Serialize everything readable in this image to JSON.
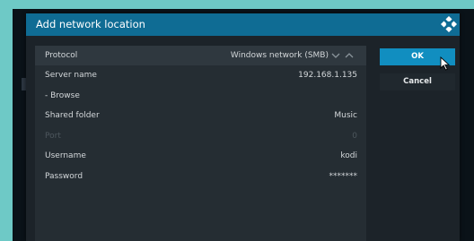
{
  "dialog": {
    "title": "Add network location"
  },
  "fields": {
    "protocol": {
      "label": "Protocol",
      "value": "Windows network (SMB)"
    },
    "server_name": {
      "label": "Server name",
      "value": "192.168.1.135"
    },
    "browse": {
      "label": "- Browse"
    },
    "shared_folder": {
      "label": "Shared folder",
      "value": "Music"
    },
    "port": {
      "label": "Port",
      "value": "0"
    },
    "username": {
      "label": "Username",
      "value": "kodi"
    },
    "password": {
      "label": "Password",
      "value": "*******"
    }
  },
  "buttons": {
    "ok_label": "OK",
    "cancel_label": "Cancel"
  },
  "colors": {
    "title_bar": "#0f6c94",
    "ok_button": "#118ec0",
    "outer_background": "#6ec9c6"
  },
  "icons": {
    "logo": "kodi-logo-icon",
    "spin_down": "chevron-down-icon",
    "spin_up": "chevron-up-icon",
    "pointer": "mouse-pointer-icon"
  }
}
